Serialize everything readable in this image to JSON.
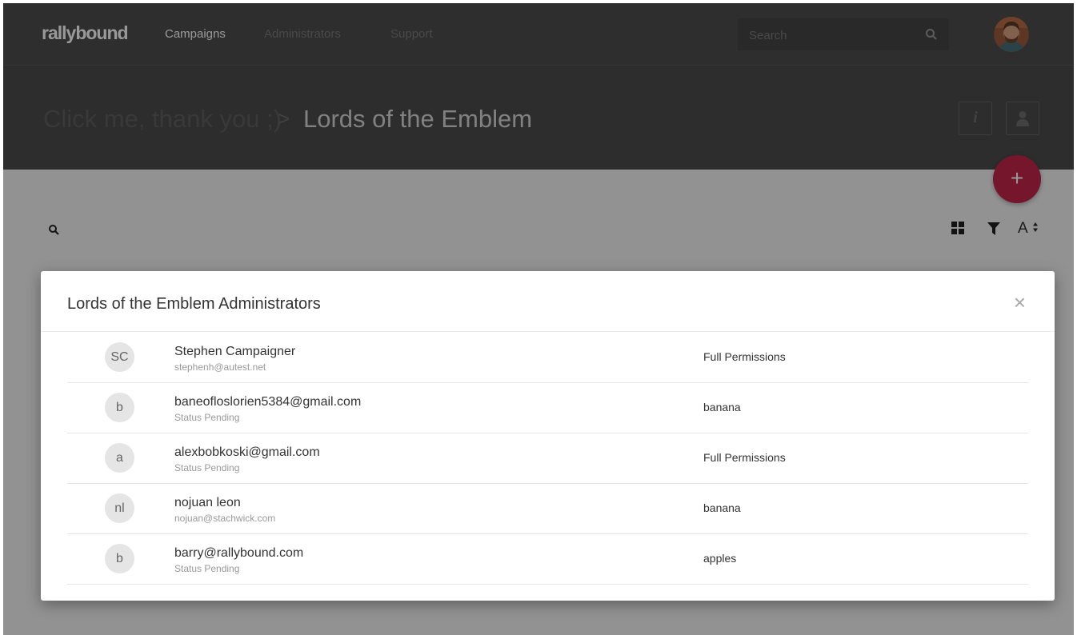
{
  "nav": {
    "logo": "rallybound",
    "links": [
      "Campaigns",
      "Administrators",
      "Support"
    ],
    "search_placeholder": "Search"
  },
  "header": {
    "breadcrumb_parent": "Click me, thank you ;)",
    "separator": ">",
    "breadcrumb_current": "Lords of the Emblem",
    "info_icon": "i"
  },
  "fab": {
    "label": "+"
  },
  "toolbar": {
    "sort_label": "A"
  },
  "modal": {
    "title": "Lords of the Emblem Administrators",
    "close": "×",
    "admins": [
      {
        "initials": "SC",
        "name": "Stephen Campaigner",
        "sub": "stephenh@autest.net",
        "permission": "Full Permissions"
      },
      {
        "initials": "b",
        "name": "baneofloslorien5384@gmail.com",
        "sub": "Status Pending",
        "permission": "banana"
      },
      {
        "initials": "a",
        "name": "alexbobkoski@gmail.com",
        "sub": "Status Pending",
        "permission": "Full Permissions"
      },
      {
        "initials": "nl",
        "name": "nojuan leon",
        "sub": "nojuan@stachwick.com",
        "permission": "banana"
      },
      {
        "initials": "b",
        "name": "barry@rallybound.com",
        "sub": "Status Pending",
        "permission": "apples"
      }
    ]
  },
  "colors": {
    "nav_bg": "#4d4d4d",
    "fab": "#c4254a",
    "overlay": "rgba(0,0,0,0.4)"
  }
}
